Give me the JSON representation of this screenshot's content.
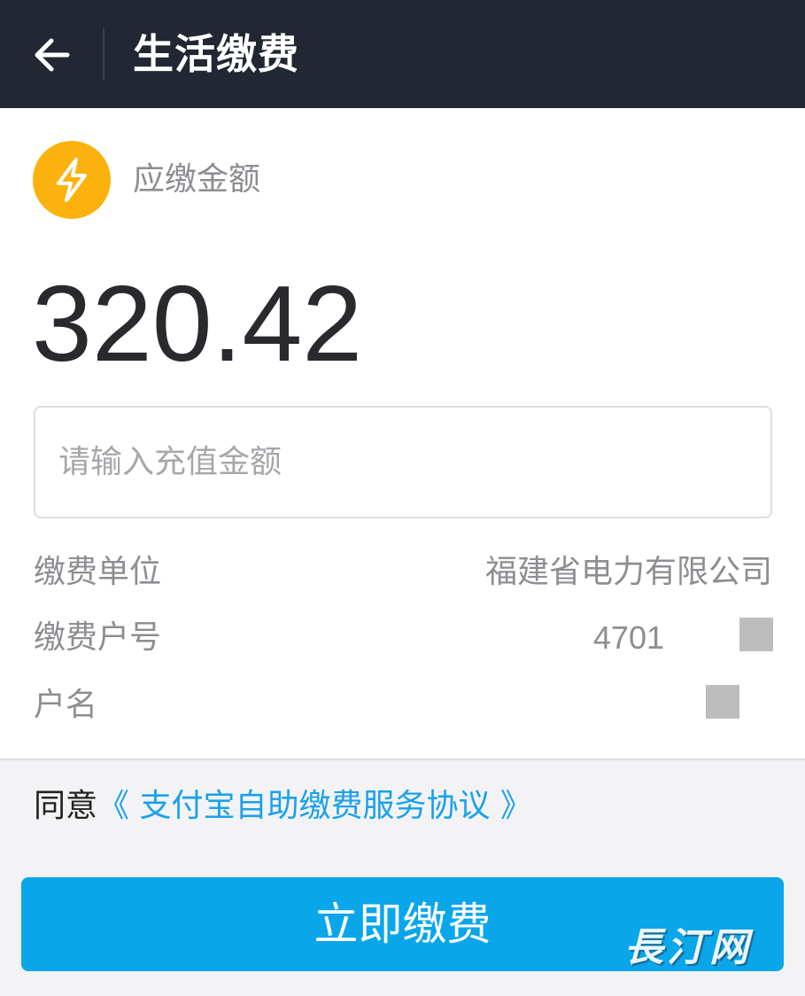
{
  "header": {
    "title": "生活缴费",
    "back_icon": "arrow-left-icon"
  },
  "bill": {
    "icon": "lightning-bolt-icon",
    "icon_color": "#fbb20f",
    "due_label": "应缴金额",
    "due_amount": "320.42"
  },
  "recharge_input": {
    "value": "",
    "placeholder": "请输入充值金额"
  },
  "details": {
    "unit_label": "缴费单位",
    "unit_value": "福建省电力有限公司",
    "account_label": "缴费户号",
    "account_value": "4701",
    "name_label": "户名",
    "name_value": ""
  },
  "agreement": {
    "prefix": "同意",
    "link_text": "《 支付宝自助缴费服务协议 》",
    "link_color": "#1aa1ec"
  },
  "pay_button": {
    "label": "立即缴费",
    "color": "#0aa6ea"
  },
  "watermark": {
    "text": "長汀网"
  }
}
